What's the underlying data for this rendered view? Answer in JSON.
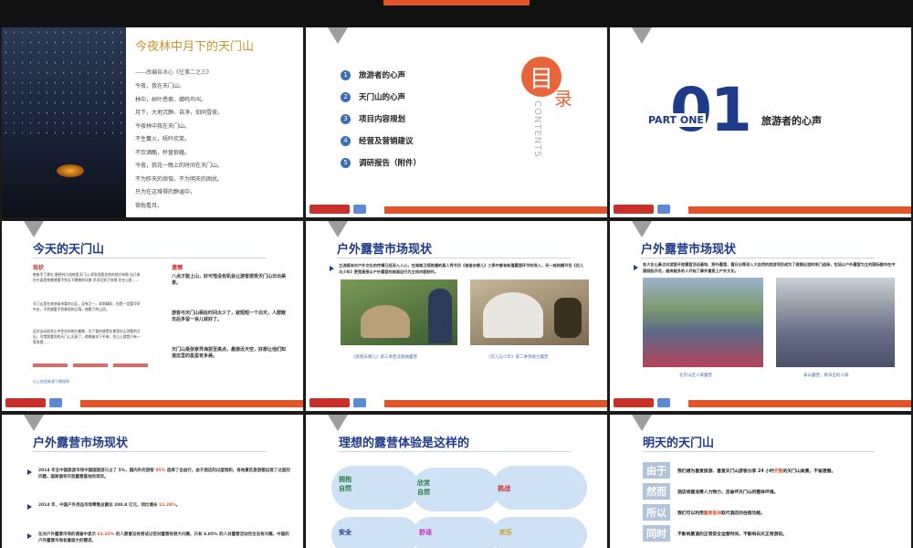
{
  "slide1": {
    "title": "今夜林中月下的天门山",
    "subtitle": "——改编自冰心《往事二之三》",
    "lines": [
      "今夜，我在天门山。",
      "林中，树叶悉索、蝉鸣鸟叫。",
      "月下，大地沉静、自净，如同雪夜。",
      "今夜林中我在天门山。",
      "不生篝火，唔吟欢笑。",
      "不饮酒酪，杯盘狼藉。",
      "今夜，我花一晚上的时间在天门山。",
      "不为昨天的烦恼，不为明天的困扰。",
      "只为在这难得的静谧中，",
      "倚枕看月。"
    ]
  },
  "slide2": {
    "toc": [
      {
        "num": "1",
        "label": "旅游者的心声"
      },
      {
        "num": "2",
        "label": "天门山的心声"
      },
      {
        "num": "3",
        "label": "项目内容规划"
      },
      {
        "num": "4",
        "label": "经营及营销建议"
      },
      {
        "num": "5",
        "label": "调研报告（附件）"
      }
    ],
    "badge_char1": "目",
    "badge_char2": "录",
    "vertical": "CONTENTS"
  },
  "slide3": {
    "part": "PART ONE",
    "big": "01",
    "title": "旅游者的心声"
  },
  "slide4": {
    "title": "今天的天门山",
    "col1_head": "现状",
    "col2_head": "遗憾",
    "col1_text": "夜来早了想欠 跟经纬几档夜里天门山 却发现我住地的地方有限 自己来在外面是夜晚就看不到天下晚晚的风景 早早回到了宾馆 住在山里……",
    "col1_text2": "天门山是在其他省市看的山区，没有之一。非常精彩，但是一定要早早中去，不然就看不到美丽的日落，夜晚了的山顶。",
    "col1_text3": "这次去玩很多山中住住的地方最美，为了要的就是在夜里在山顶看的日出，可惜我看到的天门山太高了，夜晚基本下不来，住山上就是只有一家宾馆……",
    "col1_footer": "以上信息来源于携程网",
    "col2_items": [
      "八点才能上山，好可惜没有机会让游客感受天门山日出美景。",
      "游客与天门山相处时间太少了，就短短一个白天，人群散去后多留一会儿就好了。",
      "天门山是张家界海拔至高点，最接近天空，好想让他们知道这里的星星有多美。"
    ]
  },
  "slide5": {
    "title": "户外露营市场现状",
    "intro": "主流媒体对户外文化的传播已经深入人心，在湖南卫视热播的真人秀节目《爸爸去哪儿》三季中都有帐篷露营环节的导入，另一档热播节目《花儿与少年》更是直接以户外露营的曲面运行为主线内容制作。",
    "cap1": "《爸爸去哪儿》第三季西双版纳露营",
    "cap2": "《花儿与少年》第二季英格兰露营"
  },
  "slide6": {
    "title": "户外露营市场现状",
    "intro": "各大名山景点对游客开放露营活动基地、野外露营、看日出等深入大自然的旅游项目成为了假期出游的热门选择，包括以户外露营为主的国际都市在中国掀起开花，越来越多的人开始了解并喜爱上户外文化。",
    "cap1": "北京山区人来露营",
    "cap2": "泰山露营，看日出的人群"
  },
  "slide7": {
    "title": "户外露营市场现状",
    "items": [
      {
        "pre": "2014 年全中国旅游市场中国国旅游只占了 5%，国内外的游客 ",
        "hl": "95%",
        "post": " 选择了自由行，由于酒店的过度饱和，各地景区旅游都出现了过度的问题，国家倡导开放露营基地的项目。"
      },
      {
        "pre": "2014 年，中国户外用品市场零售总额达 200.8 亿元，同比增长 ",
        "hl": "11.28%",
        "post": "。"
      },
      {
        "pre": "在对户外露营市场的调查中显示 ",
        "hl": "62.33%",
        "post": " 的人愿意没有尝试过但对露营有很大兴趣，只有 6.05% 的人对露营活动完全没有兴趣，中国的户外露营市场有着极大的需求。"
      }
    ]
  },
  "slide8": {
    "title": "理想的露营体验是这样的",
    "clouds": [
      {
        "label": "拥抱自然",
        "color": "#2a7f3f"
      },
      {
        "label": "欣赏自然",
        "color": "#2a7f3f"
      },
      {
        "label": "挑战",
        "color": "#c8302a"
      },
      {
        "label": "安全",
        "color": "#1e3a8a"
      },
      {
        "label": "舒适",
        "color": "#c030c0"
      },
      {
        "label": "欢乐",
        "color": "#c0a020"
      }
    ]
  },
  "slide9": {
    "title": "明天的天门山",
    "rows": [
      {
        "tag": "由于",
        "pre": "我们想为喜爱旅游、喜爱天门山游客分享 24 小时",
        "hl": "完整",
        "post": "的天门山美景，不留遗憾。"
      },
      {
        "tag": "然而",
        "pre": "酒店修建浪费人力物力，且破坏天门山的整体环境。",
        "hl": "",
        "post": ""
      },
      {
        "tag": "所以",
        "pre": "我们可以利用",
        "hl": "露营基地",
        "post": "取代酒店的住宿功能。"
      },
      {
        "tag": "同时",
        "pre": "不影响景道的正常安全运营时间，不影响白天正常游玩。",
        "hl": "",
        "post": ""
      }
    ]
  }
}
